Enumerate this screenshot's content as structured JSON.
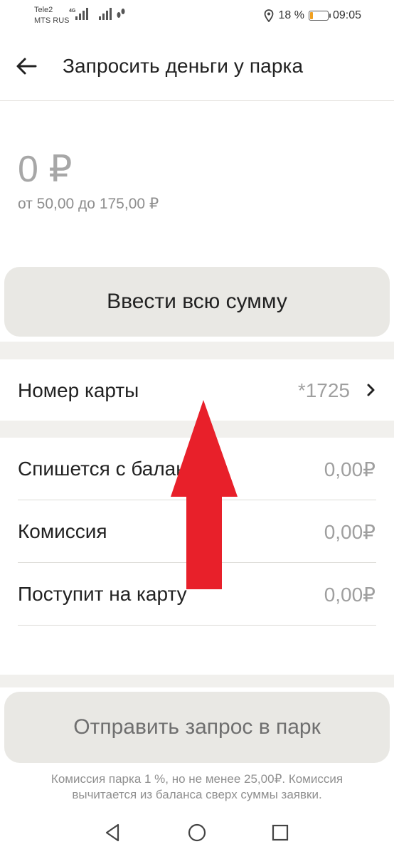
{
  "status_bar": {
    "carrier_1": "Tele2",
    "carrier_2": "MTS RUS",
    "network_type": "4G",
    "battery_percent": "18 %",
    "battery_level": 0.18,
    "time": "09:05",
    "icons": [
      "signal-icon",
      "location-icon",
      "battery-icon"
    ]
  },
  "header": {
    "title": "Запросить деньги у парка",
    "back_icon": "arrow-left-icon"
  },
  "amount": {
    "value": "0 ₽",
    "range": "от 50,00 до 175,00 ₽"
  },
  "buttons": {
    "enter_full_amount": "Ввести всю сумму",
    "send_request": "Отправить запрос в парк"
  },
  "card": {
    "label": "Номер карты",
    "value": "*1725",
    "icon": "chevron-right-icon"
  },
  "details": [
    {
      "label": "Спишется с баланса",
      "value": "0,00₽"
    },
    {
      "label": "Комиссия",
      "value": "0,00₽"
    },
    {
      "label": "Поступит на карту",
      "value": "0,00₽"
    }
  ],
  "note": "Комиссия парка 1 %, но не менее 25,00₽. Комиссия вычитается из баланса сверх суммы заявки.",
  "nav": {
    "back": "triangle-back-icon",
    "home": "circle-home-icon",
    "recents": "square-recents-icon"
  },
  "annotation": {
    "color": "#e8202a",
    "icon": "red-arrow-up-icon"
  },
  "colors": {
    "button_bg": "#e9e8e4",
    "separator": "#f1f0ed",
    "muted_text": "#a7a7a7"
  }
}
